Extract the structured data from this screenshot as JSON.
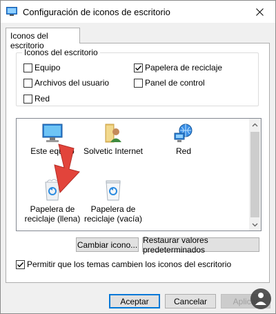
{
  "window": {
    "title": "Configuración de iconos de escritorio"
  },
  "tabs": [
    {
      "label": "Iconos del escritorio"
    }
  ],
  "group": {
    "legend": "Iconos del escritorio",
    "checkboxes": [
      {
        "label": "Equipo",
        "checked": false
      },
      {
        "label": "Papelera de reciclaje",
        "checked": true
      },
      {
        "label": "Archivos del usuario",
        "checked": false
      },
      {
        "label": "Panel de control",
        "checked": false
      },
      {
        "label": "Red",
        "checked": false
      }
    ]
  },
  "icons": [
    {
      "label": "Este equipo",
      "icon": "computer-icon"
    },
    {
      "label": "Solvetic Internet",
      "icon": "user-folder-icon"
    },
    {
      "label": "Red",
      "icon": "network-icon"
    },
    {
      "label": "Papelera de reciclaje (llena)",
      "icon": "recycle-bin-full-icon"
    },
    {
      "label": "Papelera de reciclaje (vacía)",
      "icon": "recycle-bin-empty-icon"
    }
  ],
  "buttons": {
    "change_icon": "Cambiar icono...",
    "restore_defaults": "Restaurar valores predeterminados",
    "accept": "Aceptar",
    "cancel": "Cancelar",
    "apply": "Aplicar"
  },
  "allow_themes": {
    "label": "Permitir que los temas cambien los iconos del escritorio",
    "checked": true
  },
  "colors": {
    "accent": "#0078d7",
    "arrow": "#e2443b",
    "folder": "#e8c46a"
  }
}
